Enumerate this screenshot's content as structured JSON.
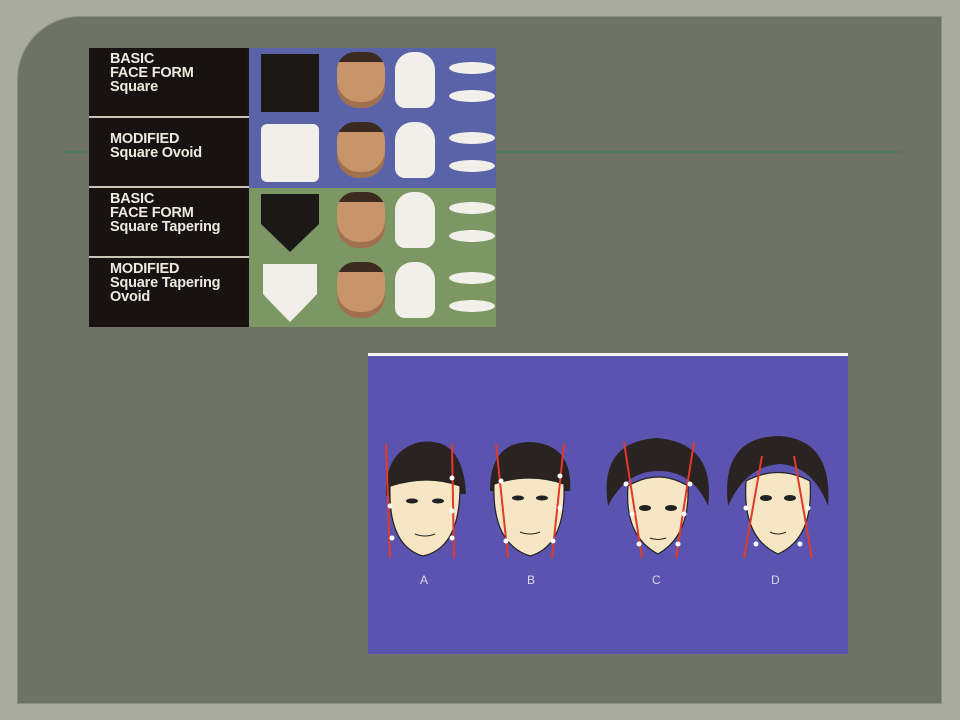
{
  "face_form_chart": {
    "rows": [
      {
        "lines": [
          "BASIC",
          "FACE FORM",
          "Square"
        ],
        "panel_color": "#5b63a8",
        "shape": "square",
        "shape_color": "#1b1818"
      },
      {
        "lines": [
          "MODIFIED",
          "Square Ovoid"
        ],
        "panel_color": "#5b63a8",
        "shape": "square-rounded",
        "shape_color": "#f1efe9"
      },
      {
        "lines": [
          "BASIC",
          "FACE FORM",
          "Square Tapering"
        ],
        "panel_color": "#7d9764",
        "shape": "tapering",
        "shape_color": "#1b1818"
      },
      {
        "lines": [
          "MODIFIED",
          "Square Tapering",
          "Ovoid"
        ],
        "panel_color": "#7d9764",
        "shape": "tapering",
        "shape_color": "#f1efe9"
      }
    ]
  },
  "faces_figure": {
    "labels": [
      "A",
      "B",
      "C",
      "D"
    ],
    "background": "#5a54b0",
    "outline_color": "#e03a2a"
  },
  "colors": {
    "slide_bg": "#6f7365",
    "outer_bg": "#a9ab9d",
    "rule": "#4f7a5c"
  }
}
